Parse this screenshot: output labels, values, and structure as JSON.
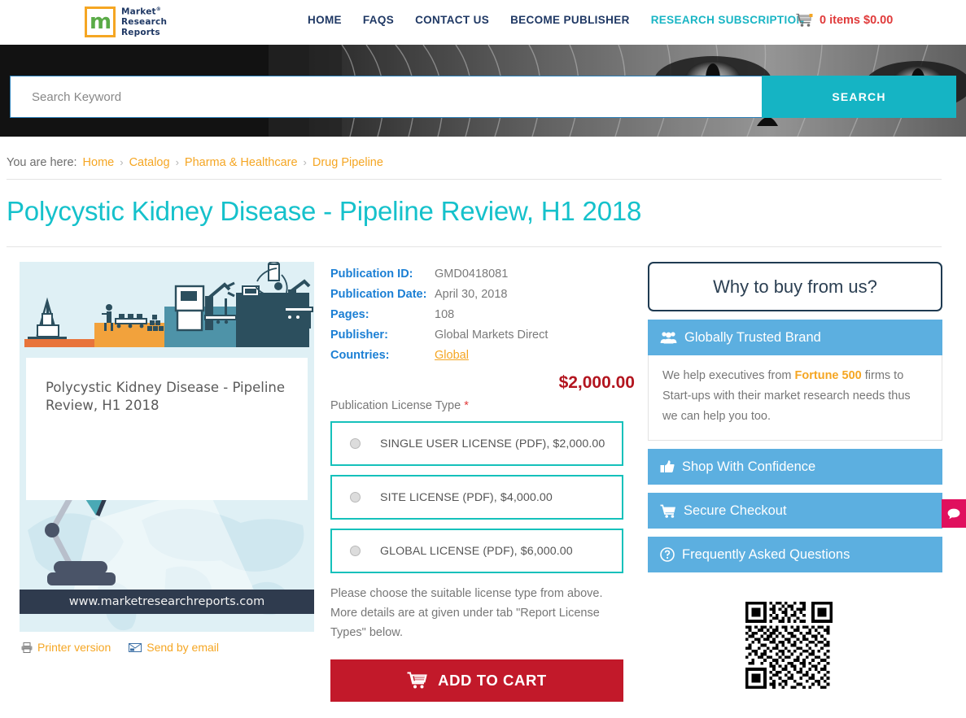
{
  "header": {
    "logo": {
      "mark_letter": "m",
      "line1": "Market",
      "line2": "Research",
      "line3": "Reports",
      "registered": "®"
    },
    "nav": [
      {
        "label": "HOME",
        "accent": false
      },
      {
        "label": "FAQS",
        "accent": false
      },
      {
        "label": "CONTACT US",
        "accent": false
      },
      {
        "label": "BECOME PUBLISHER",
        "accent": false
      },
      {
        "label": "RESEARCH SUBSCRIPTION",
        "accent": true
      }
    ],
    "cart": {
      "icon": "shopping-cart-icon",
      "label": "0 items $0.00"
    }
  },
  "search": {
    "placeholder": "Search Keyword",
    "value": "",
    "button_label": "SEARCH"
  },
  "breadcrumb": {
    "prefix": "You are here:",
    "separator": "›",
    "items": [
      "Home",
      "Catalog",
      "Pharma & Healthcare",
      "Drug Pipeline"
    ]
  },
  "page": {
    "title": "Polycystic Kidney Disease - Pipeline Review, H1 2018"
  },
  "cover": {
    "title": "Polycystic Kidney Disease - Pipeline Review, H1 2018",
    "url": "www.marketresearchreports.com",
    "links": [
      {
        "label": "Printer version",
        "icon": "printer-icon"
      },
      {
        "label": "Send by email",
        "icon": "envelope-icon"
      }
    ]
  },
  "details": {
    "rows": [
      {
        "label": "Publication ID:",
        "value": "GMD0418081",
        "accent": false
      },
      {
        "label": "Publication Date:",
        "value": "April 30, 2018",
        "accent": false
      },
      {
        "label": "Pages:",
        "value": "108",
        "accent": false
      },
      {
        "label": "Publisher:",
        "value": "Global Markets Direct",
        "accent": false
      },
      {
        "label": "Countries:",
        "value": "Global",
        "accent": true
      }
    ],
    "price": "$2,000.00"
  },
  "license": {
    "label": "Publication License Type",
    "required_marker": "*",
    "options": [
      {
        "label": "SINGLE USER LICENSE (PDF), $2,000.00",
        "selected": false
      },
      {
        "label": "SITE LICENSE (PDF), $4,000.00",
        "selected": false
      },
      {
        "label": "GLOBAL LICENSE (PDF), $6,000.00",
        "selected": false
      }
    ],
    "note": "Please choose the suitable license type from above. More details are at given under tab \"Report License Types\" below.",
    "add_to_cart_label": "ADD TO CART"
  },
  "sidebar": {
    "why_title": "Why to buy from us?",
    "panels": [
      {
        "icon": "users-group-icon",
        "title": "Globally Trusted Brand",
        "body_before": "We help executives from ",
        "body_highlight": "Fortune 500",
        "body_after": " firms to Start-ups with their market research needs thus we can help you too."
      },
      {
        "icon": "thumbs-up-icon",
        "title": "Shop With Confidence"
      },
      {
        "icon": "cart-icon",
        "title": "Secure Checkout"
      },
      {
        "icon": "question-circle-icon",
        "title": "Frequently Asked Questions"
      }
    ],
    "qr_alt": "qr-code"
  },
  "chat": {
    "icon": "chat-bubble-icon"
  },
  "colors": {
    "teal": "#15c1cb",
    "brand_navy": "#1f3864",
    "orange": "#f5a623",
    "red": "#c2192a",
    "panel_blue": "#5cafe0",
    "link_blue": "#1b7fd4",
    "chat_pink": "#e0105e"
  }
}
